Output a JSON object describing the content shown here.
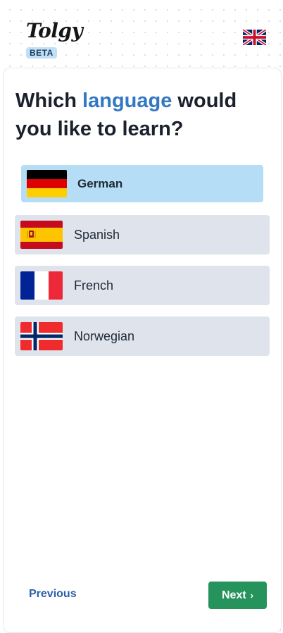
{
  "header": {
    "logo": "Tolgy",
    "badge": "BETA",
    "language_icon": "uk-flag-icon"
  },
  "question": {
    "prefix": "Which ",
    "highlight": "language",
    "suffix": " would you like to learn?",
    "highlight_color": "#3378c3"
  },
  "options": [
    {
      "label": "German",
      "icon": "german-flag-icon",
      "selected": true
    },
    {
      "label": "Spanish",
      "icon": "spanish-flag-icon",
      "selected": false
    },
    {
      "label": "French",
      "icon": "french-flag-icon",
      "selected": false
    },
    {
      "label": "Norwegian",
      "icon": "norwegian-flag-icon",
      "selected": false
    }
  ],
  "footer": {
    "previous_label": "Previous",
    "next_label": "Next",
    "next_icon": "chevron-right-icon",
    "next_color": "#25935b"
  },
  "colors": {
    "selected_bg": "#b5ddf5",
    "option_bg": "#dfe4ec"
  }
}
